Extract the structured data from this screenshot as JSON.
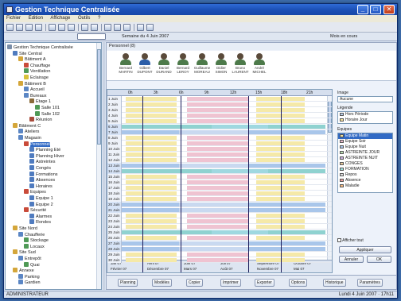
{
  "window": {
    "title": "Gestion Technique Centralisée",
    "minimize": "_",
    "maximize": "□",
    "close": "✕"
  },
  "menu": [
    "Fichier",
    "Edition",
    "Affichage",
    "Outils",
    "?"
  ],
  "toolbar2": {
    "left_value": "",
    "center_label": "Semaine du 4 Juin 2007",
    "right_label": "Mois en cours"
  },
  "tree": {
    "items": [
      {
        "label": "Gestion Technique Centralisée",
        "indent": 0,
        "color": "#7b8ea8"
      },
      {
        "label": "Site Central",
        "indent": 1,
        "color": "#4f7bbf"
      },
      {
        "label": "Bâtiment A",
        "indent": 2,
        "color": "#d4a63a"
      },
      {
        "label": "Chauffage",
        "indent": 3,
        "color": "#c94b3a"
      },
      {
        "label": "Ventilation",
        "indent": 3,
        "color": "#4f9a56"
      },
      {
        "label": "Eclairage",
        "indent": 3,
        "color": "#d8c23a"
      },
      {
        "label": "Bâtiment B",
        "indent": 2,
        "color": "#d4a63a"
      },
      {
        "label": "Accueil",
        "indent": 3,
        "color": "#5b86c4"
      },
      {
        "label": "Bureaux",
        "indent": 3,
        "color": "#5b86c4"
      },
      {
        "label": "Etage 1",
        "indent": 4,
        "color": "#8a6b3a"
      },
      {
        "label": "Salle 101",
        "indent": 5,
        "color": "#4f9a56"
      },
      {
        "label": "Salle 102",
        "indent": 5,
        "color": "#4f9a56"
      },
      {
        "label": "Réunion",
        "indent": 4,
        "color": "#a84a3a"
      },
      {
        "label": "Bâtiment C",
        "indent": 1,
        "color": "#d4a63a"
      },
      {
        "label": "Ateliers",
        "indent": 2,
        "color": "#5b86c4"
      },
      {
        "label": "Magasin",
        "indent": 2,
        "color": "#5b86c4"
      },
      {
        "label": "Personnel",
        "indent": 3,
        "color": "#c94b3a",
        "selected": true
      },
      {
        "label": "Planning Eté",
        "indent": 4,
        "color": "#4f7bbf"
      },
      {
        "label": "Planning Hiver",
        "indent": 4,
        "color": "#4f7bbf"
      },
      {
        "label": "Astreintes",
        "indent": 4,
        "color": "#4f7bbf"
      },
      {
        "label": "Congés",
        "indent": 4,
        "color": "#4f7bbf"
      },
      {
        "label": "Formations",
        "indent": 4,
        "color": "#4f7bbf"
      },
      {
        "label": "Absences",
        "indent": 4,
        "color": "#4f7bbf"
      },
      {
        "label": "Horaires",
        "indent": 4,
        "color": "#4f7bbf"
      },
      {
        "label": "Equipes",
        "indent": 3,
        "color": "#c94b3a"
      },
      {
        "label": "Equipe 1",
        "indent": 4,
        "color": "#4f7bbf"
      },
      {
        "label": "Equipe 2",
        "indent": 4,
        "color": "#4f7bbf"
      },
      {
        "label": "Sécurité",
        "indent": 3,
        "color": "#c94b3a"
      },
      {
        "label": "Alarmes",
        "indent": 4,
        "color": "#4f7bbf"
      },
      {
        "label": "Rondes",
        "indent": 4,
        "color": "#4f7bbf"
      },
      {
        "label": "Site Nord",
        "indent": 1,
        "color": "#d4a63a"
      },
      {
        "label": "Chaufferie",
        "indent": 2,
        "color": "#5b86c4"
      },
      {
        "label": "Stockage",
        "indent": 3,
        "color": "#4f9a56"
      },
      {
        "label": "Locaux",
        "indent": 3,
        "color": "#4f9a56"
      },
      {
        "label": "Site Sud",
        "indent": 1,
        "color": "#d4a63a"
      },
      {
        "label": "Entrepôt",
        "indent": 2,
        "color": "#5b86c4"
      },
      {
        "label": "Quai",
        "indent": 3,
        "color": "#4f9a56"
      },
      {
        "label": "Annexe",
        "indent": 1,
        "color": "#d4a63a"
      },
      {
        "label": "Parking",
        "indent": 2,
        "color": "#5b86c4"
      },
      {
        "label": "Gardien",
        "indent": 2,
        "color": "#5b86c4"
      }
    ]
  },
  "people_bar_label": "Personnel (8)",
  "people": [
    {
      "name": "Bernard\nMARTIN"
    },
    {
      "name": "Gilbert\nDUPONT",
      "selected": true
    },
    {
      "name": "Daniel\nDURAND"
    },
    {
      "name": "Bernard\nLEROY"
    },
    {
      "name": "Guillaume\nMOREAU"
    },
    {
      "name": "Didier\nSIMON"
    },
    {
      "name": "Bruno\nLAURENT"
    },
    {
      "name": "André\nMICHEL"
    }
  ],
  "grid": {
    "hours": [
      "0h",
      "3h",
      "6h",
      "9h",
      "12h",
      "15h",
      "18h",
      "21h"
    ],
    "days": [
      "1 Juin",
      "2 Juin",
      "3 Juin",
      "4 Juin",
      "5 Juin",
      "6 Juin",
      "7 Juin",
      "8 Juin",
      "9 Juin",
      "10 Juin",
      "11 Juin",
      "12 Juin",
      "13 Juin",
      "14 Juin",
      "15 Juin",
      "16 Juin",
      "17 Juin",
      "18 Juin",
      "19 Juin",
      "20 Juin",
      "21 Juin",
      "22 Juin",
      "23 Juin",
      "24 Juin",
      "25 Juin",
      "26 Juin",
      "27 Juin",
      "28 Juin",
      "29 Juin",
      "30 Juin"
    ],
    "footer_labels": [
      "Jan 07",
      "Avril 07",
      "Juin 07",
      "Juil 07",
      "Septembre 07",
      "Octobre 07"
    ],
    "footer_labels2": [
      "Février 07",
      "Décembre 07",
      "Mars 07",
      "Août 07",
      "Novembre 07",
      "Mai 07"
    ]
  },
  "right": {
    "label1": "Image",
    "dropdown": "Aucune",
    "label2": "Légende",
    "legend_items": [
      {
        "label": "Hors Période",
        "color": "#b8cce8"
      },
      {
        "label": "Horaire Jour",
        "color": "#f2e29a"
      }
    ],
    "label3": "Equipes",
    "team_items": [
      {
        "label": "Equipe Matin",
        "color": "#f2e29a",
        "selected": true
      },
      {
        "label": "Equipe Soir",
        "color": "#e8b6c8"
      },
      {
        "label": "Equipe Nuit",
        "color": "#a8c4e8"
      },
      {
        "label": "ASTREINTE JOUR",
        "color": "#b8dcb0"
      },
      {
        "label": "ASTREINTE NUIT",
        "color": "#c8b0dc"
      },
      {
        "label": "CONGES",
        "color": "#e8c89a"
      },
      {
        "label": "FORMATION",
        "color": "#9adcd8"
      },
      {
        "label": "Repos",
        "color": "#dcdcdc"
      },
      {
        "label": "Absence",
        "color": "#e89a9a"
      },
      {
        "label": "Maladie",
        "color": "#f2b880"
      }
    ],
    "checkbox_label": "Afficher tout",
    "btn1": "Appliquer",
    "btn2": "Annuler",
    "btn3": "OK"
  },
  "bottom_buttons": [
    "Planning",
    "Modèles",
    "Copier",
    "Imprimer",
    "Exporter",
    "Options",
    "Historique",
    "Paramètres"
  ],
  "status": {
    "left": "ADMINISTRATEUR",
    "right": "Lundi 4 Juin 2007 · 17h11"
  },
  "colors": {
    "yellow": "#f5e9a8",
    "pink": "#efc3d1",
    "blue": "#a9c6ea",
    "teal": "#8fd2d0",
    "accent": "#316ac5"
  }
}
